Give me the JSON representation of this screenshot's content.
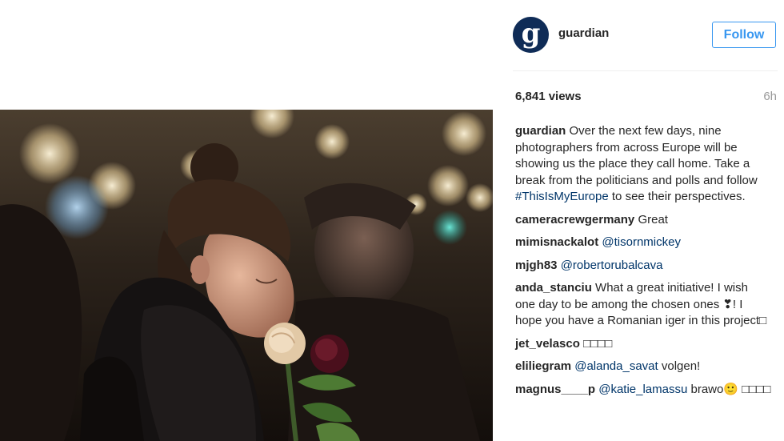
{
  "post": {
    "username": "guardian",
    "follow_label": "Follow",
    "views": "6,841 views",
    "time_ago": "6h",
    "caption": {
      "user": "guardian",
      "text_before_tag": "Over the next few days, nine photographers from across Europe will be showing us the place they call home. Take a break from the politicians and polls and follow",
      "hashtag": "#ThisIsMyEurope",
      "text_after_tag": "to see their perspectives."
    }
  },
  "comments": [
    {
      "user": "cameracrewgermany",
      "text": "Great",
      "mention": ""
    },
    {
      "user": "mimisnackalot",
      "text": "",
      "mention": "@tisornmickey"
    },
    {
      "user": "mjgh83",
      "text": "",
      "mention": "@robertorubalcava"
    },
    {
      "user": "anda_stanciu",
      "text": "What a great initiative! I wish one day to be among the chosen ones ❣! I hope you have a Romanian iger in this project□",
      "mention": ""
    },
    {
      "user": "jet_velasco",
      "text": "□□□□",
      "mention": ""
    },
    {
      "user": "eliliegram",
      "mention": "@alanda_savat",
      "text": "volgen!"
    },
    {
      "user": "magnus____p",
      "mention": "@katie_lamassu",
      "text": "brawo🙂 □□□□"
    }
  ],
  "colors": {
    "link": "#003569",
    "follow": "#3897f0",
    "avatar_bg": "#0f2c57",
    "muted": "#999999"
  },
  "icons": {
    "avatar": "guardian-g-logo"
  }
}
